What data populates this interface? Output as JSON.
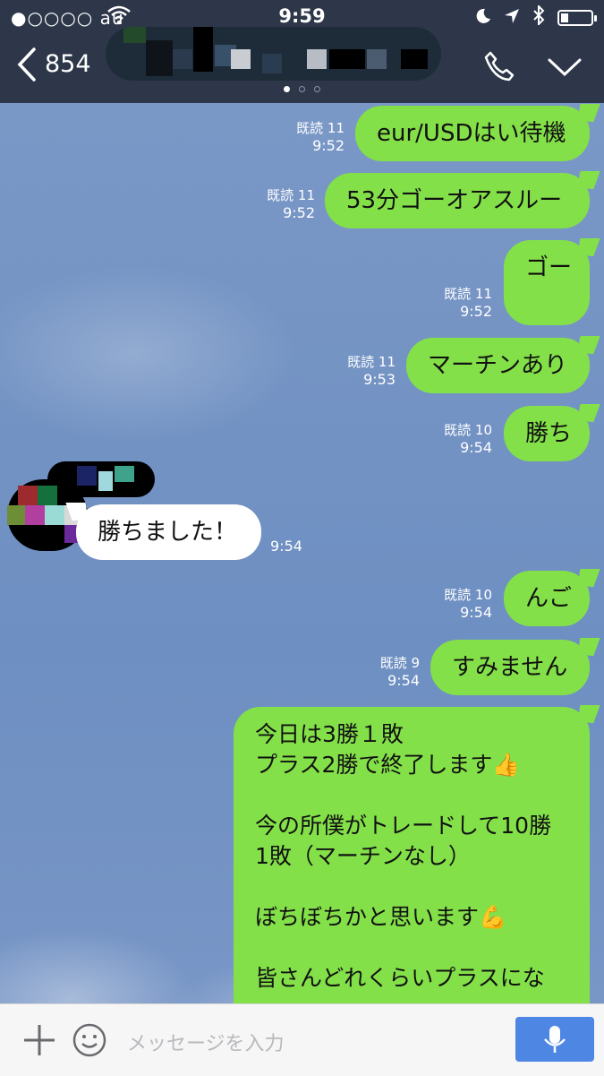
{
  "status_bar": {
    "carrier": "●○○○○ au",
    "time": "9:59"
  },
  "header": {
    "back_count": "854"
  },
  "messages": [
    {
      "text": "eur/USDはい待機",
      "read": "既読 11",
      "time": "9:52"
    },
    {
      "text": "53分ゴーオアスルー",
      "read": "既読 11",
      "time": "9:52"
    },
    {
      "text": "ゴー",
      "read": "既読 11",
      "time": "9:52"
    },
    {
      "text": "マーチンあり",
      "read": "既読 11",
      "time": "9:53"
    },
    {
      "text": "勝ち",
      "read": "既読 10",
      "time": "9:54"
    },
    {
      "text": "勝ちました！",
      "time": "9:54"
    },
    {
      "text": "んご",
      "read": "既読 10",
      "time": "9:54"
    },
    {
      "text": "すみません",
      "read": "既読 9",
      "time": "9:54"
    },
    {
      "text": "今日は3勝１敗\nプラス2勝で終了します👍\n\n今の所僕がトレードして10勝\n1敗（マーチンなし）\n\nぼちぼちかと思います💪\n\n皆さんどれくらいプラスにな"
    }
  ],
  "input": {
    "placeholder": "メッセージを入力"
  },
  "icons": [
    "signal-dots",
    "wifi-icon",
    "moon-icon",
    "location-arrow-icon",
    "bluetooth-icon",
    "battery-icon",
    "back-chevron-icon",
    "phone-icon",
    "chevron-down-icon",
    "plus-icon",
    "emoji-icon",
    "mic-icon"
  ],
  "colors": {
    "header_bg": "#2d3749",
    "chat_bg": "#7b97c4",
    "sent_bubble": "#84e049",
    "received_bubble": "#ffffff",
    "mic_button": "#4e86e4"
  }
}
